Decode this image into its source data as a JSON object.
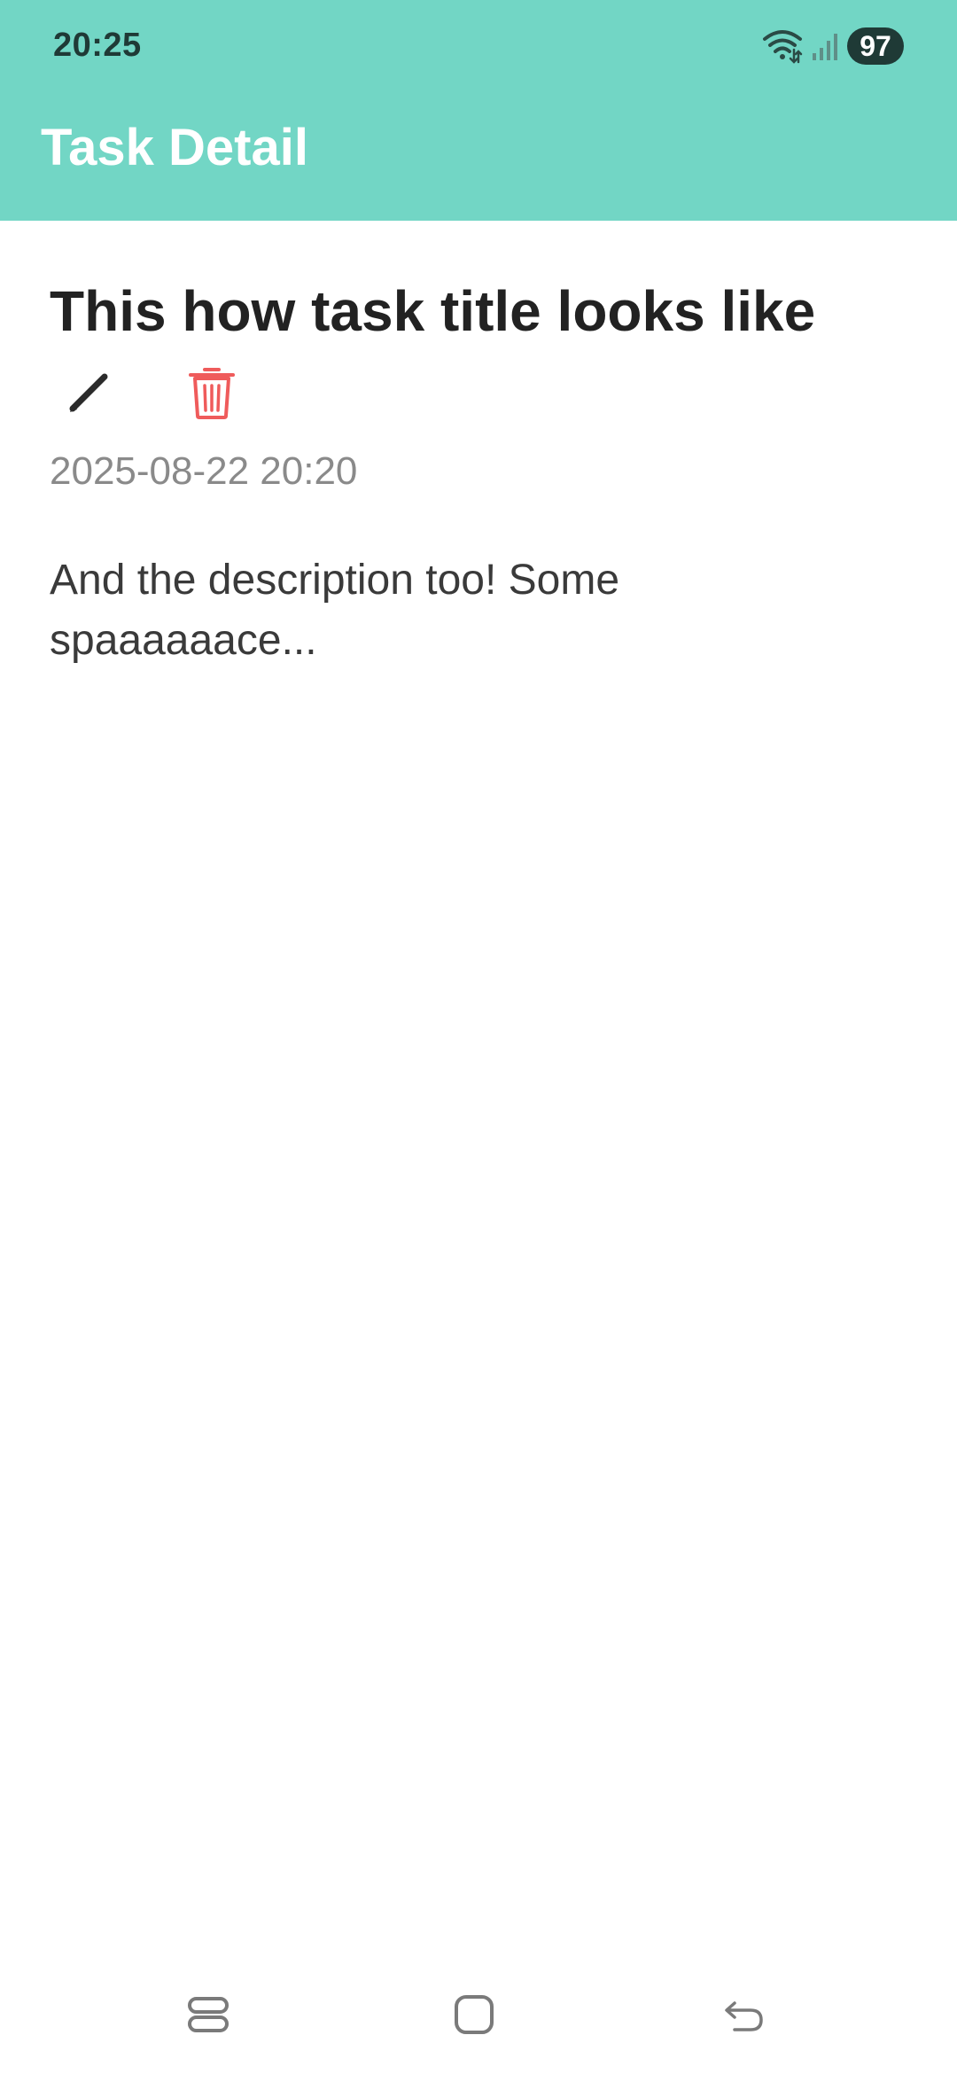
{
  "status_bar": {
    "time": "20:25",
    "battery": "97",
    "icons": [
      "wifi-icon",
      "signal-icon"
    ]
  },
  "app_bar": {
    "title": "Task Detail",
    "background_color": "#72d6c5"
  },
  "task": {
    "title": "This how task title looks like",
    "date": "2025-08-22 20:20",
    "description": "And the description too! Some spaaaaaace..."
  },
  "actions": {
    "edit_icon": "pencil-icon",
    "delete_icon": "trash-icon",
    "delete_color": "#ef5b5b"
  },
  "nav_bar": {
    "icons": [
      "recents-icon",
      "home-icon",
      "back-icon"
    ]
  }
}
